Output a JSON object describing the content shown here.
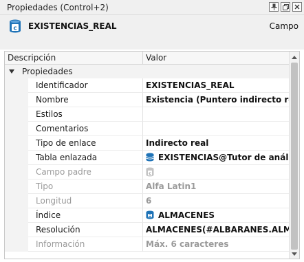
{
  "window": {
    "title": "Propiedades (Control+2)",
    "buttons": {
      "pin": "🖈",
      "restore": "❐",
      "close": "✕"
    }
  },
  "header": {
    "object_name": "EXISTENCIAS_REAL",
    "object_type": "Campo",
    "icon": "field-c-icon",
    "icon_letter": "c",
    "accent_color": "#1f73b7"
  },
  "grid": {
    "columns": {
      "description": "Descripción",
      "value": "Valor"
    },
    "category": "Propiedades",
    "rows": [
      {
        "name": "Identificador",
        "value": "EXISTENCIAS_REAL",
        "disabled": false
      },
      {
        "name": "Nombre",
        "value": "Existencia (Puntero indirecto real)",
        "disabled": false
      },
      {
        "name": "Estilos",
        "value": "",
        "disabled": false
      },
      {
        "name": "Comentarios",
        "value": "",
        "disabled": false
      },
      {
        "name": "Tipo de enlace",
        "value": "Indirecto real",
        "disabled": false
      },
      {
        "name": "Tabla enlazada",
        "value": "EXISTENCIAS@Tutor de análisis (P...",
        "disabled": false,
        "icon": "database-icon"
      },
      {
        "name": "Campo padre",
        "value": "",
        "disabled": true,
        "icon": "field-c-icon"
      },
      {
        "name": "Tipo",
        "value": "Alfa Latin1",
        "disabled": true
      },
      {
        "name": "Longitud",
        "value": "6",
        "disabled": true
      },
      {
        "name": "Índice",
        "value": "ALMACENES",
        "disabled": false,
        "icon": "index-icon"
      },
      {
        "name": "Resolución",
        "value": "ALMACENES(#ALBARANES.ALMACEN...",
        "disabled": false
      },
      {
        "name": "Información",
        "value": "Máx. 6 caracteres",
        "disabled": true
      }
    ]
  }
}
